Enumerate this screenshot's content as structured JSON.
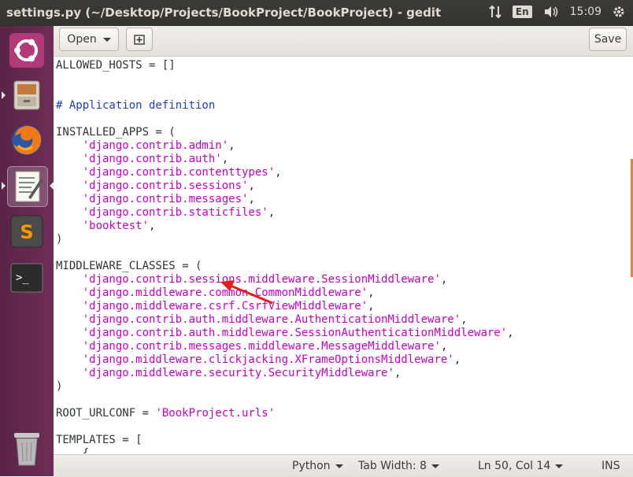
{
  "window": {
    "title": "settings.py (~/Desktop/Projects/BookProject/BookProject) - gedit"
  },
  "tray": {
    "keyboard_layout": "En",
    "clock": "15:09"
  },
  "launcher": {
    "items": [
      "dash-home",
      "files",
      "firefox",
      "text-editor",
      "sublime-text",
      "terminal",
      "trash"
    ]
  },
  "toolbar": {
    "open_label": "Open",
    "save_label": "Save"
  },
  "editor": {
    "lines": [
      "ALLOWED_HOSTS = []",
      "",
      "",
      "# Application definition",
      "",
      "INSTALLED_APPS = (",
      "    'django.contrib.admin',",
      "    'django.contrib.auth',",
      "    'django.contrib.contenttypes',",
      "    'django.contrib.sessions',",
      "    'django.contrib.messages',",
      "    'django.contrib.staticfiles',",
      "    'booktest',",
      ")",
      "",
      "MIDDLEWARE_CLASSES = (",
      "    'django.contrib.sessions.middleware.SessionMiddleware',",
      "    'django.middleware.common.CommonMiddleware',",
      "    'django.middleware.csrf.CsrfViewMiddleware',",
      "    'django.contrib.auth.middleware.AuthenticationMiddleware',",
      "    'django.contrib.auth.middleware.SessionAuthenticationMiddleware',",
      "    'django.contrib.messages.middleware.MessageMiddleware',",
      "    'django.middleware.clickjacking.XFrameOptionsMiddleware',",
      "    'django.middleware.security.SecurityMiddleware',",
      ")",
      "",
      "ROOT_URLCONF = 'BookProject.urls'",
      "",
      "TEMPLATES = [",
      "    {"
    ]
  },
  "statusbar": {
    "language": "Python",
    "tab_width": "Tab Width: 8",
    "position": "Ln 50, Col 14",
    "mode": "INS"
  },
  "colors": {
    "string": "#c800c8",
    "comment": "#1c3ec8",
    "launcher_bg": "#6e2d57",
    "annotation_arrow": "#e02020"
  }
}
